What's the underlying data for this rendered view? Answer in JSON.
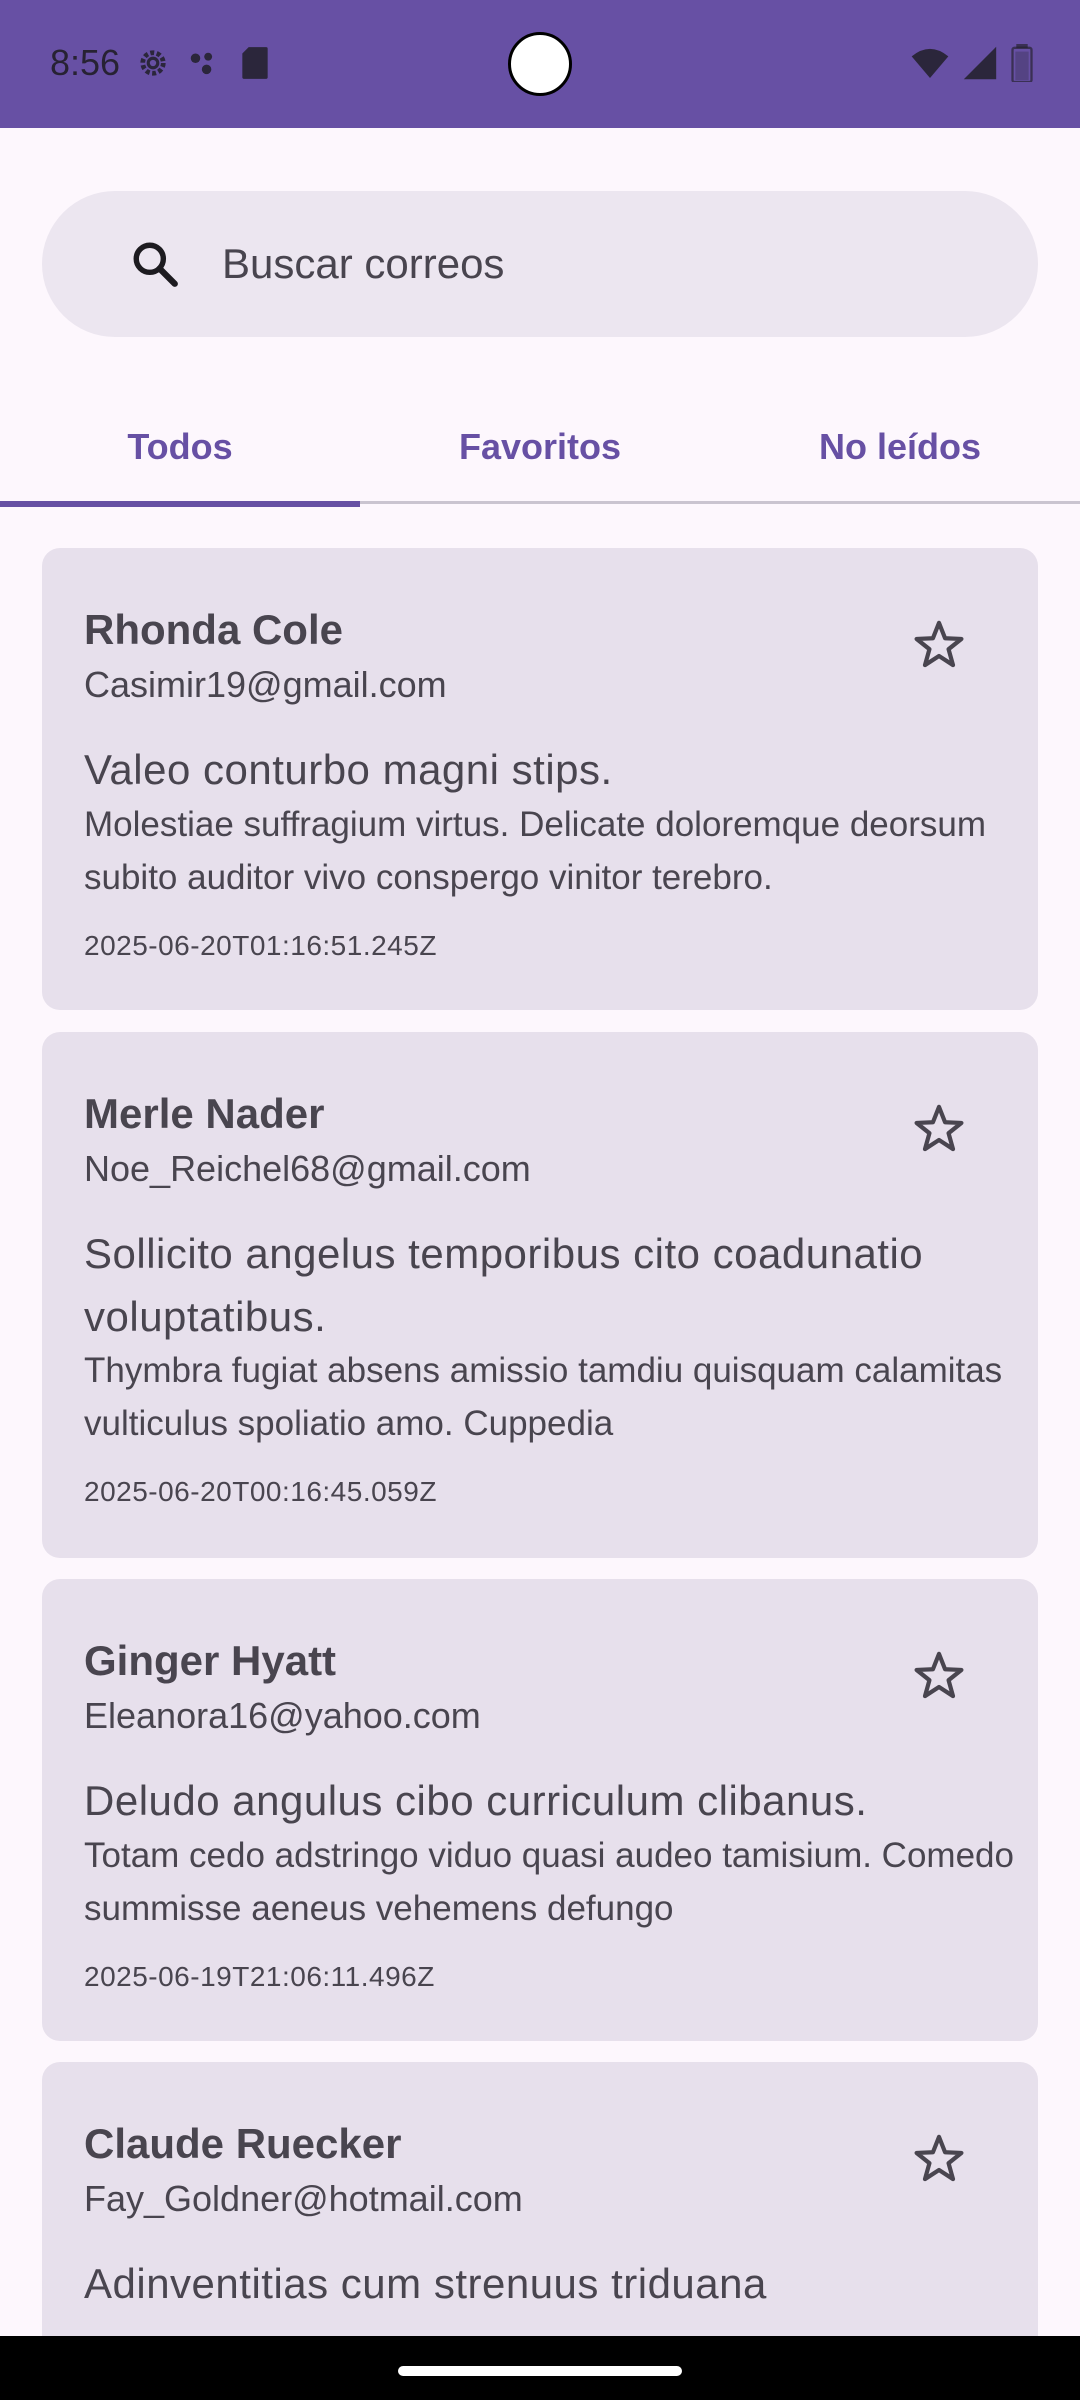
{
  "status_bar": {
    "time": "8:56",
    "left_icons": [
      "gear-icon",
      "dots-icon",
      "sd-card-icon"
    ],
    "right_icons": [
      "wifi-icon",
      "signal-icon",
      "battery-icon"
    ],
    "color": "#6750a4"
  },
  "search": {
    "placeholder": "Buscar correos",
    "icon": "search-icon"
  },
  "tabs": [
    {
      "label": "Todos",
      "selected": true
    },
    {
      "label": "Favoritos",
      "selected": false
    },
    {
      "label": "No leídos",
      "selected": false
    }
  ],
  "emails": [
    {
      "sender": "Rhonda Cole",
      "email": "Casimir19@gmail.com",
      "subject": "Valeo conturbo magni stips.",
      "body": "Molestiae suffragium virtus. Delicate doloremque deorsum subito auditor vivo conspergo vinitor terebro.",
      "date": "2025-06-20T01:16:51.245Z",
      "starred": false
    },
    {
      "sender": "Merle Nader",
      "email": "Noe_Reichel68@gmail.com",
      "subject": "Sollicito angelus temporibus cito coadunatio voluptatibus.",
      "body": "Thymbra fugiat absens amissio tamdiu quisquam calamitas vulticulus spoliatio amo. Cuppedia",
      "date": "2025-06-20T00:16:45.059Z",
      "starred": false
    },
    {
      "sender": "Ginger Hyatt",
      "email": "Eleanora16@yahoo.com",
      "subject": "Deludo angulus cibo curriculum clibanus.",
      "body": "Totam cedo adstringo viduo quasi audeo tamisium. Comedo summisse aeneus vehemens defungo",
      "date": "2025-06-19T21:06:11.496Z",
      "starred": false
    },
    {
      "sender": "Claude Ruecker",
      "email": "Fay_Goldner@hotmail.com",
      "subject": "Adinventitias cum strenuus triduana",
      "body": "",
      "date": "",
      "starred": false
    }
  ],
  "colors": {
    "primary": "#6750a4",
    "background": "#fdf7fd",
    "card": "#e7e0ec",
    "search_bg": "#ece6f0",
    "text": "#49454f",
    "divider": "#cac4d0"
  }
}
